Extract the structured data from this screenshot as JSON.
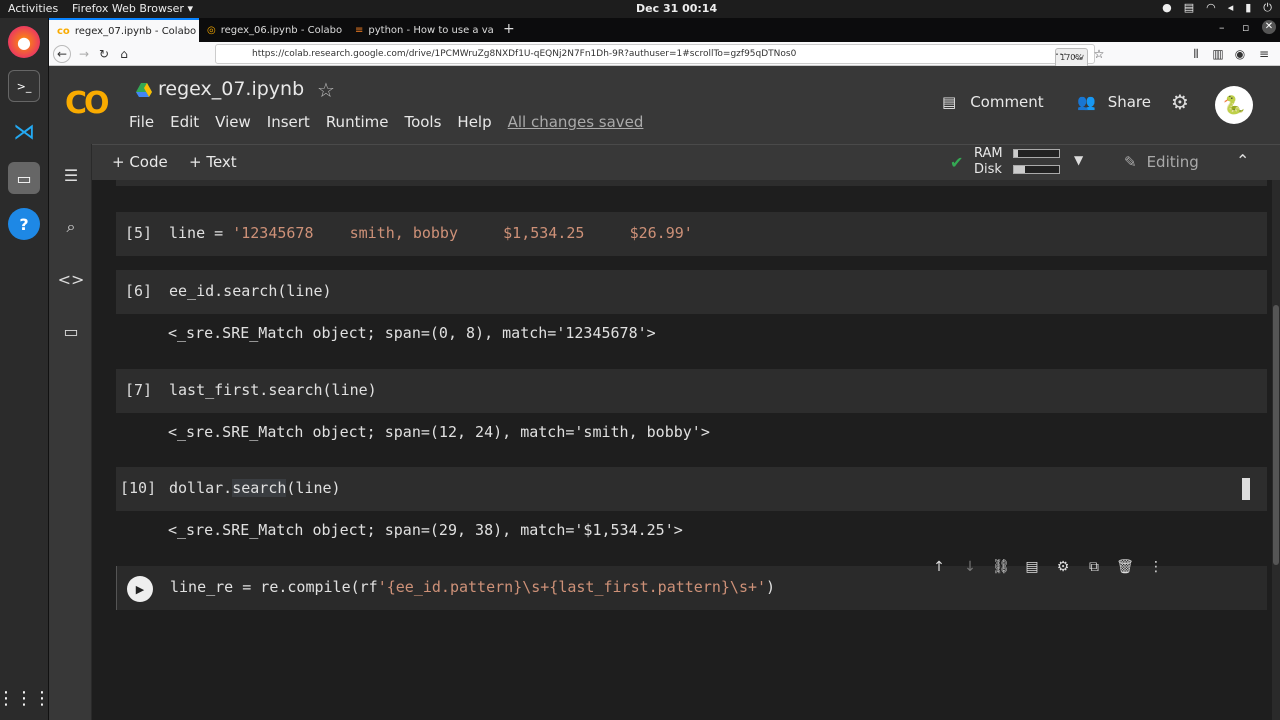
{
  "desktop": {
    "activities": "Activities",
    "app_name": "Firefox Web Browser ▾",
    "clock": "Dec 31  00:14"
  },
  "browser": {
    "tabs": [
      {
        "label": "regex_07.ipynb - Colabo",
        "active": true
      },
      {
        "label": "regex_06.ipynb - Colabo",
        "active": false
      },
      {
        "label": "python - How to use a va",
        "active": false
      }
    ],
    "url": "https://colab.research.google.com/drive/1PCMWruZg8NXDf1U-qEQNj2N7Fn1Dh-9R?authuser=1#scrollTo=gzf95qDTNos0",
    "zoom": "170%"
  },
  "colab": {
    "logo": "CO",
    "title": "regex_07.ipynb",
    "menu": [
      "File",
      "Edit",
      "View",
      "Insert",
      "Runtime",
      "Tools",
      "Help"
    ],
    "save_status": "All changes saved",
    "comment_label": "Comment",
    "share_label": "Share",
    "add_code_label": "+ Code",
    "add_text_label": "+ Text",
    "ram_label": "RAM",
    "disk_label": "Disk",
    "ram_fill": 0.08,
    "disk_fill": 0.25,
    "editing_label": "Editing"
  },
  "cells": [
    {
      "count": "[5]",
      "code_prefix": "line = ",
      "code_string": "'12345678    smith, bobby     $1,534.25     $26.99'"
    },
    {
      "count": "[6]",
      "code": "ee_id.search(line)",
      "output": "<_sre.SRE_Match object; span=(0, 8), match='12345678'>"
    },
    {
      "count": "[7]",
      "code": "last_first.search(line)",
      "output": "<_sre.SRE_Match object; span=(12, 24), match='smith, bobby'>"
    },
    {
      "count": "[10]",
      "code_a": "dollar.",
      "code_hl": "search",
      "code_b": "(line)",
      "output": "<_sre.SRE_Match object; span=(29, 38), match='$1,534.25'>"
    },
    {
      "code_prefix": "line_re = re.compile(rf",
      "code_string": "'{ee_id.pattern}\\s+{last_first.pattern}\\s+'",
      "code_suffix": ")"
    }
  ]
}
